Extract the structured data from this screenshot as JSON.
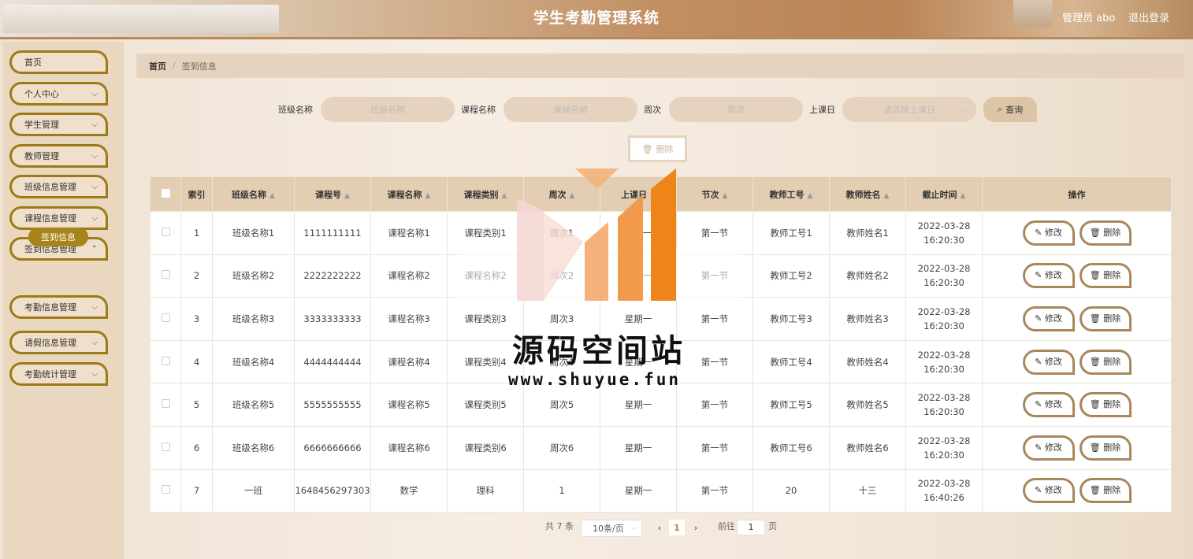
{
  "header": {
    "title": "学生考勤管理系统",
    "user": "管理员 abo",
    "logout": "退出登录"
  },
  "sidebar": {
    "items": [
      {
        "label": "首页"
      },
      {
        "label": "个人中心"
      },
      {
        "label": "学生管理"
      },
      {
        "label": "教师管理"
      },
      {
        "label": "班级信息管理"
      },
      {
        "label": "课程信息管理"
      },
      {
        "label": "签到信息管理"
      },
      {
        "label": "考勤信息管理"
      },
      {
        "label": "请假信息管理"
      },
      {
        "label": "考勤统计管理"
      }
    ],
    "active_sub": "签到信息"
  },
  "breadcrumb": {
    "home": "首页",
    "sep": "/",
    "current": "签到信息"
  },
  "search": {
    "class_label": "班级名称",
    "class_placeholder": "班级名称",
    "course_label": "课程名称",
    "course_placeholder": "课程名称",
    "week_label": "周次",
    "week_placeholder": "周次",
    "day_label": "上课日",
    "day_placeholder": "请选择上课日",
    "query_label": "查询"
  },
  "toolbar": {
    "delete_label": "删除"
  },
  "table": {
    "headers": [
      "索引",
      "班级名称",
      "课程号",
      "课程名称",
      "课程类别",
      "周次",
      "上课日",
      "节次",
      "教师工号",
      "教师姓名",
      "截止时间",
      "操作"
    ],
    "rows": [
      [
        "1",
        "班级名称1",
        "1111111111",
        "课程名称1",
        "课程类别1",
        "周次1",
        "星期一",
        "第一节",
        "教师工号1",
        "教师姓名1",
        "2022-03-28 16:20:30"
      ],
      [
        "2",
        "班级名称2",
        "2222222222",
        "课程名称2",
        "课程名称2",
        "周次2",
        "星期一",
        "第一节",
        "教师工号2",
        "教师姓名2",
        "2022-03-28 16:20:30"
      ],
      [
        "3",
        "班级名称3",
        "3333333333",
        "课程名称3",
        "课程类别3",
        "周次3",
        "星期一",
        "第一节",
        "教师工号3",
        "教师姓名3",
        "2022-03-28 16:20:30"
      ],
      [
        "4",
        "班级名称4",
        "4444444444",
        "课程名称4",
        "课程类别4",
        "周次4",
        "星期一",
        "第一节",
        "教师工号4",
        "教师姓名4",
        "2022-03-28 16:20:30"
      ],
      [
        "5",
        "班级名称5",
        "5555555555",
        "课程名称5",
        "课程类别5",
        "周次5",
        "星期一",
        "第一节",
        "教师工号5",
        "教师姓名5",
        "2022-03-28 16:20:30"
      ],
      [
        "6",
        "班级名称6",
        "6666666666",
        "课程名称6",
        "课程类别6",
        "周次6",
        "星期一",
        "第一节",
        "教师工号6",
        "教师姓名6",
        "2022-03-28 16:20:30"
      ],
      [
        "7",
        "一班",
        "1648456297303",
        "数学",
        "理科",
        "1",
        "星期一",
        "第一节",
        "20",
        "十三",
        "2022-03-28 16:40:26"
      ]
    ],
    "edit_label": "修改",
    "delete_label": "删除"
  },
  "pagination": {
    "total": "共 7 条",
    "page_size": "10条/页",
    "current_page": "1",
    "goto_label": "前往",
    "goto_value": "1",
    "page_unit": "页"
  },
  "watermark": {
    "text": "源码空间站",
    "url": "www.shuyue.fun"
  },
  "colors": {
    "accent": "#a7831b",
    "header": "#c18f62",
    "table_head": "#e3cdb3"
  }
}
